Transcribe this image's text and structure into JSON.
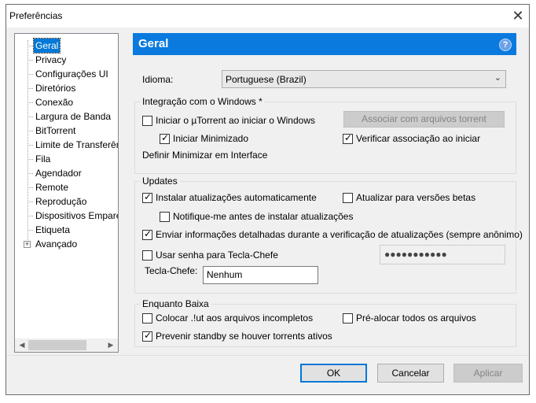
{
  "window": {
    "title": "Preferências"
  },
  "sidebar": {
    "items": [
      {
        "label": "Geral",
        "selected": true
      },
      {
        "label": "Privacy"
      },
      {
        "label": "Configurações UI"
      },
      {
        "label": "Diretórios"
      },
      {
        "label": "Conexão"
      },
      {
        "label": "Largura de Banda"
      },
      {
        "label": "BitTorrent"
      },
      {
        "label": "Limite de Transferência"
      },
      {
        "label": "Fila"
      },
      {
        "label": "Agendador"
      },
      {
        "label": "Remote"
      },
      {
        "label": "Reprodução"
      },
      {
        "label": "Dispositivos Emparelhados"
      },
      {
        "label": "Etiqueta"
      },
      {
        "label": "Avançado",
        "expandable": true
      }
    ]
  },
  "panel": {
    "title": "Geral",
    "language_label": "Idioma:",
    "language_value": "Portuguese (Brazil)",
    "integration": {
      "title": "Integração com o Windows *",
      "start_with_windows": "Iniciar o µTorrent ao iniciar o Windows",
      "start_with_windows_checked": false,
      "start_minimized": "Iniciar Minimizado",
      "start_minimized_checked": true,
      "associate_button": "Associar com arquivos torrent",
      "check_association": "Verificar associação ao iniciar",
      "check_association_checked": true,
      "minimize_interface": "Definir Minimizar em Interface"
    },
    "updates": {
      "title": "Updates",
      "auto_install": "Instalar atualizações automaticamente",
      "auto_install_checked": true,
      "beta": "Atualizar para versões betas",
      "beta_checked": false,
      "notify_before": "Notifique-me antes de instalar atualizações",
      "notify_before_checked": false,
      "send_info": "Enviar informações detalhadas durante a verificação de atualizações (sempre anônimo)",
      "send_info_checked": true,
      "boss_password": "Usar senha para Tecla-Chefe",
      "boss_password_checked": false,
      "password_value": "●●●●●●●●●●●",
      "boss_key_label": "Tecla-Chefe:",
      "boss_key_value": "Nenhum"
    },
    "downloading": {
      "title": "Enquanto Baixa",
      "append_ut": "Colocar .!ut aos arquivos incompletos",
      "append_ut_checked": false,
      "prealloc": "Pré-alocar todos os arquivos",
      "prealloc_checked": false,
      "prevent_standby": "Prevenir standby se houver torrents ativos",
      "prevent_standby_checked": true
    }
  },
  "footer": {
    "ok": "OK",
    "cancel": "Cancelar",
    "apply": "Aplicar"
  },
  "icons": {
    "close": "close-icon",
    "help": "help-icon",
    "expand": "plus-expander-icon",
    "dropdown": "chevron-down-icon"
  }
}
